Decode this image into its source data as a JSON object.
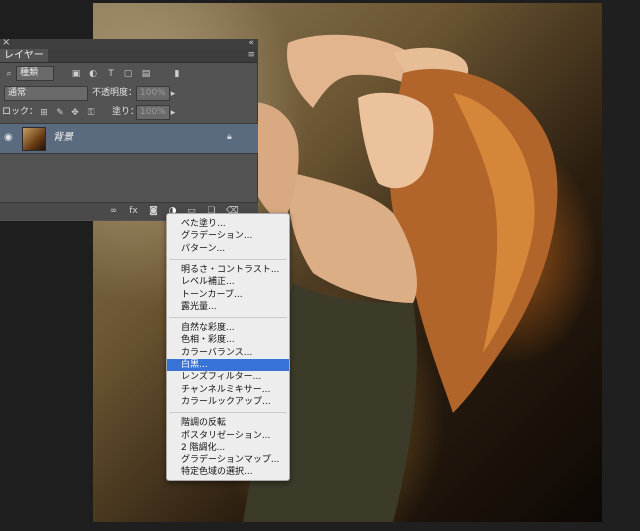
{
  "panel": {
    "tab": "レイヤー",
    "close_icon": "×",
    "collapse_icon": "«",
    "menu_icon": "≡",
    "filter": {
      "kind": "種類"
    },
    "blend": {
      "mode": "通常",
      "opacity_label": "不透明度：",
      "opacity": "100%"
    },
    "lock": {
      "label": "ロック：",
      "fill_label": "塗り：",
      "fill": "100%"
    },
    "layer": {
      "name": "背景"
    }
  },
  "menu": {
    "groups": [
      [
        "べた塗り...",
        "グラデーション...",
        "パターン..."
      ],
      [
        "明るさ・コントラスト...",
        "レベル補正...",
        "トーンカーブ...",
        "露光量..."
      ],
      [
        "自然な彩度...",
        "色相・彩度...",
        "カラーバランス...",
        "白黒...",
        "レンズフィルター...",
        "チャンネルミキサー...",
        "カラールックアップ..."
      ],
      [
        "階調の反転",
        "ポスタリゼーション...",
        "2 階調化...",
        "グラデーションマップ...",
        "特定色域の選択..."
      ]
    ],
    "selected": "白黒..."
  },
  "colors": {
    "panel": "#535353",
    "selected_layer": "#5a6b80",
    "menu_highlight": "#3874d8",
    "menu_bg": "#ededed"
  }
}
